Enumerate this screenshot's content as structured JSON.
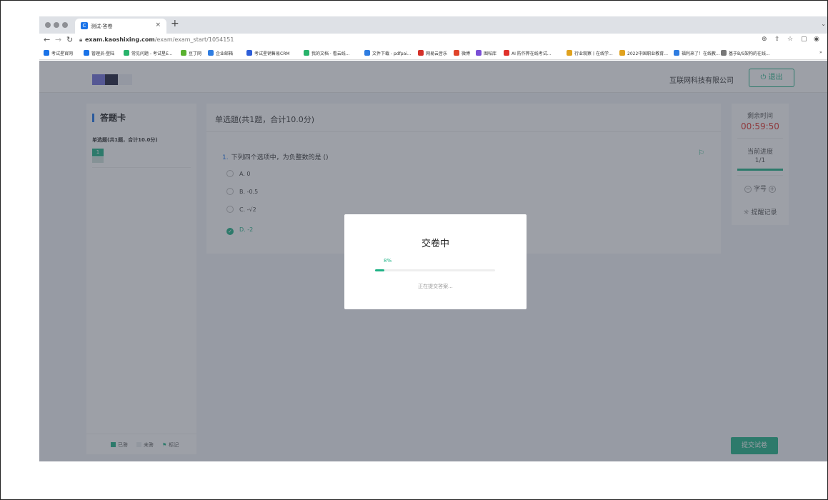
{
  "browser": {
    "tab_title": "测试-答卷",
    "tab_close": "×",
    "new_tab": "+",
    "url_host": "exam.kaoshixing.com",
    "url_path": "/exam/exam_start/1054151",
    "bookmarks": [
      {
        "label": "考试星官网",
        "color": "#1a73e8"
      },
      {
        "label": "管理员-登陆",
        "color": "#1a73e8"
      },
      {
        "label": "常见问题 - 考试星E...",
        "color": "#29b36b"
      },
      {
        "label": "豆丁网",
        "color": "#5ab130"
      },
      {
        "label": "企业邮箱",
        "color": "#2f7de1"
      },
      {
        "label": "考试星销售易CRM",
        "color": "#2d5ed8"
      },
      {
        "label": "我的文档 · 看云线...",
        "color": "#29b36b"
      },
      {
        "label": "文件下载 - pdfpai...",
        "color": "#2f7de1"
      },
      {
        "label": "网易云音乐",
        "color": "#d4312a"
      },
      {
        "label": "微博",
        "color": "#e0442a"
      },
      {
        "label": "图帖库",
        "color": "#7a4fd6"
      },
      {
        "label": "AI 防作弊在线考试...",
        "color": "#e0322b"
      },
      {
        "label": "行业观察丨在线学...",
        "color": "#e0a21f"
      },
      {
        "label": "2022中国职业教育...",
        "color": "#e0a21f"
      },
      {
        "label": "福利来了！在线教...",
        "color": "#2f7de1"
      },
      {
        "label": "基于B/S架构的在线...",
        "color": "#777777"
      }
    ]
  },
  "header": {
    "company": "互联网科技有限公司",
    "logout_label": "退出",
    "logout_icon": "⏻"
  },
  "answer_card": {
    "title": "答题卡",
    "section_label": "单选题(共1题，合计10.0分)",
    "question_numbers": [
      "1"
    ],
    "legend": {
      "answered": "已答",
      "unanswered": "未答",
      "marked": "标记"
    }
  },
  "question_panel": {
    "header": "单选题(共1题，合计10.0分)",
    "question_number": "1.",
    "question_text": "下列四个选项中，为负整数的是 ()",
    "options": [
      {
        "label": "A. 0",
        "selected": false
      },
      {
        "label": "B. -0.5",
        "selected": false
      },
      {
        "label": "C. -√2",
        "selected": false
      },
      {
        "label": "D. -2",
        "selected": true
      }
    ]
  },
  "side_panel": {
    "remaining_label": "剩余时间",
    "remaining_time": "00:59:50",
    "progress_label": "当前进度",
    "progress_value": "1/1",
    "progress_fraction": 1.0,
    "font_label": "字号",
    "font_minus": "−",
    "font_plus": "+",
    "remind_label": "提醒记录",
    "remind_icon": "☼"
  },
  "submit_label": "提交试卷",
  "modal": {
    "title": "交卷中",
    "percent_text": "8%",
    "percent_value": 8,
    "status": "正在提交答案..."
  },
  "colors": {
    "accent": "#1fb286",
    "primary": "#1a73e8",
    "timer": "#e0322b"
  }
}
